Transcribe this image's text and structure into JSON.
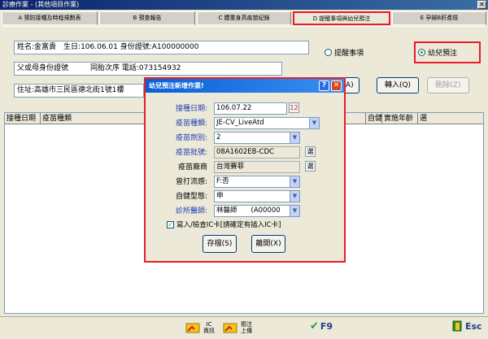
{
  "window": {
    "title": "診療作業 - (其他項目作業)",
    "close_glyph": "✕"
  },
  "tabs": [
    {
      "label": "A 預防接種及時程規劃表"
    },
    {
      "label": "B 預查報告"
    },
    {
      "label": "C 體重身高疫苗紀錄"
    },
    {
      "label": "D 提醒事項與幼兒預注"
    },
    {
      "label": "E 孕婦B肝產檢"
    }
  ],
  "patient": {
    "name_line": "姓名:金富貴　生日:106.06.01  身份證號:A100000000",
    "parent_line": "父或母身份證號　　　同胎次序  電話:073154932",
    "address_line": "住址:高雄市三民區德北街1號1樓"
  },
  "radios": {
    "remind": "提醒事項",
    "child_prereg": "幼兒預注",
    "selected": "child_prereg"
  },
  "buttons": {
    "add": "新增(A)",
    "import": "轉入(Q)",
    "delete": "刪除(Z)"
  },
  "grid": {
    "columns": [
      "接種日期",
      "疫苗種類",
      "自健型態",
      "實施年齡",
      "選"
    ]
  },
  "dialog": {
    "title": "幼兒預注新增作業!",
    "help_glyph": "?",
    "close_glyph": "✕",
    "fields": {
      "date_label": "接種日期:",
      "date_value": "106.07.22",
      "date_btn": "12",
      "vaccine_label": "疫苗種類:",
      "vaccine_value": "JE-CV_LiveAtd",
      "dose_label": "疫苗劑別:",
      "dose_value": "2",
      "lot_label": "疫苗批號:",
      "lot_value": "08A1602EB-CDC",
      "lot_btn": "選",
      "maker_label": "疫苗廠商",
      "maker_value": "台灣賽菲",
      "maker_btn": "選",
      "outflow_label": "曾打流感:",
      "outflow_value": "F:否",
      "selfpay_label": "自健型態:",
      "selfpay_value": "申",
      "doctor_label": "診所醫師:",
      "doctor_value": "林醫師　　(A00000"
    },
    "checkbox": {
      "label": "寫入/檢查IC卡[請確定有插入IC卡]",
      "checked": "✓"
    },
    "save": "存檔(S)",
    "leave": "離開(X)"
  },
  "statusbar": {
    "ic": "IC\n資訊",
    "prereg": "預注\n上傳",
    "f9": "F9",
    "esc": "Esc"
  }
}
